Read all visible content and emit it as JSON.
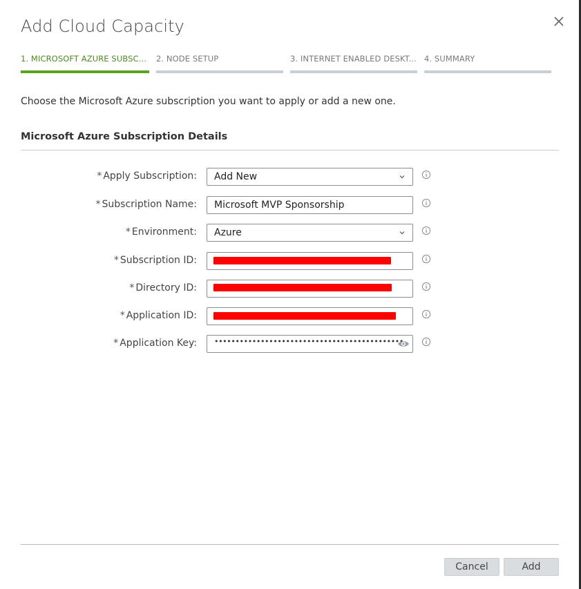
{
  "dialog": {
    "title": "Add Cloud Capacity",
    "close_icon": "close-icon"
  },
  "steps": [
    {
      "label": "1. MICROSOFT AZURE SUBSCR...",
      "active": true
    },
    {
      "label": "2. NODE SETUP",
      "active": false
    },
    {
      "label": "3. INTERNET ENABLED DESKT...",
      "active": false
    },
    {
      "label": "4. SUMMARY",
      "active": false
    }
  ],
  "intro": "Choose the Microsoft Azure subscription you want to apply or add a new one.",
  "section_title": "Microsoft Azure Subscription Details",
  "form": {
    "required_mark": "*",
    "apply_subscription": {
      "label": "Apply Subscription:",
      "value": "Add New"
    },
    "subscription_name": {
      "label": "Subscription Name:",
      "value": "Microsoft MVP Sponsorship"
    },
    "environment": {
      "label": "Environment:",
      "value": "Azure"
    },
    "subscription_id": {
      "label": "Subscription ID:",
      "value_redacted": true
    },
    "directory_id": {
      "label": "Directory ID:",
      "value_redacted": true
    },
    "application_id": {
      "label": "Application ID:",
      "value_redacted": true
    },
    "application_key": {
      "label": "Application Key:",
      "value_masked": "•••••••••••••••••••••••••••••••••••••••••••••"
    }
  },
  "buttons": {
    "cancel": "Cancel",
    "add": "Add"
  },
  "colors": {
    "active_step": "#5aa220",
    "inactive_step": "#c8ced3",
    "redaction": "#ff0000",
    "button_bg": "#dadde0"
  }
}
